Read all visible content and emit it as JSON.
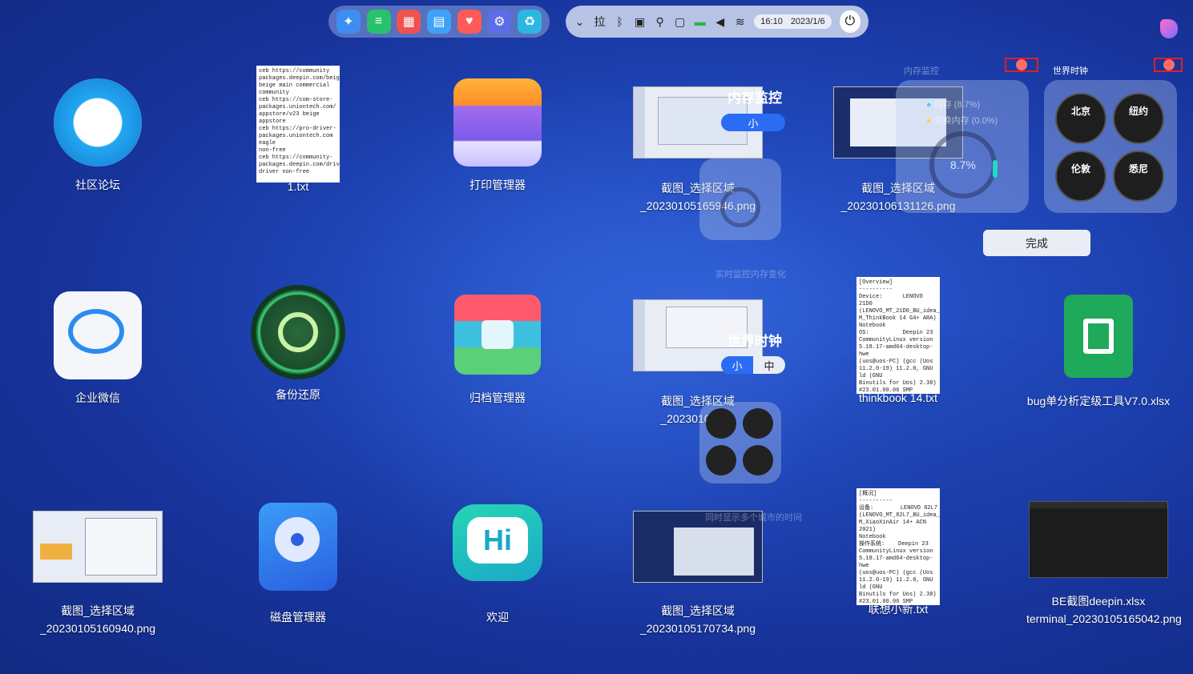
{
  "dock": {
    "icons": [
      "launcher-icon",
      "multitask-icon",
      "app-store-icon",
      "file-manager-icon",
      "gift-icon",
      "settings-icon",
      "trash-icon"
    ]
  },
  "tray": {
    "time": "16:10",
    "date": "2023/1/6"
  },
  "desktop": {
    "items": [
      {
        "label": "社区论坛"
      },
      {
        "label": "1.txt"
      },
      {
        "label": "打印管理器"
      },
      {
        "label": "截图_选择区域\n_20230105165946.png"
      },
      {
        "label": "截图_选择区域\n_20230106131126.png"
      },
      {
        "label": "企业微信"
      },
      {
        "label": "备份还原"
      },
      {
        "label": "归档管理器"
      },
      {
        "label": "截图_选择区域\n_20230105170"
      },
      {
        "label": "thinkbook 14.txt"
      },
      {
        "label": "bug单分析定级工具V7.0.xlsx"
      },
      {
        "label": "截图_选择区域\n_20230105160940.png"
      },
      {
        "label": "磁盘管理器"
      },
      {
        "label": "欢迎"
      },
      {
        "label": "截图_选择区域\n_20230105170734.png"
      },
      {
        "label": "联想小新.txt"
      },
      {
        "label": "BE截图deepin.xlsx"
      },
      {
        "label": "terminal_20230105165042.png"
      }
    ],
    "doc1_text": "ceb https://community\npackages.deepin.com/beige/\nbeige main commercial\ncommunity\nceb https://com-store-\npackages.uniontech.com/\nappstore/v23 beige appstore\nceb https://pro-driver-\npackages.uniontech.com eagle\nnon-free\nceb https://community-\npackages.deepin.com/driver/\ndriver non-free",
    "doc2_text": "[Overview]\n----------\nDevice:      LENOVO 21D0\n(LENOVO_MT_21D0_BU_idea_F\nM_ThinkBook 14 G4+ ARA)\nNotebook\nOS:          Deepin 23\nCommunityLinux version\n5.18.17-amd64-desktop-hwe\n(uos@uos-PC) (gcc (Uos\n11.2.0-19) 11.2.0, GNU ld (GNU\nBinutils for Uos) 2.38)\n#23.01.00.06 SMP\nPREEMPT_DYNAMIC Mon Oct 31",
    "doc3_text": "[概况]\n----------\n设备:        LENOVO 82L7\n(LENOVO_MT_82L7_BU_idea_F\nM_XiaoXinAir 14+ ACN 2021)\nNotebook\n操作系统:    Deepin 23\nCommunityLinux version\n5.18.17-amd64-desktop-hwe\n(uos@uos-PC) (gcc (Uos\n11.2.0-19) 11.2.0, GNU ld (GNU\nBinutils for Uos) 2.38)\n#23.01.00.06 SMP\nPREEMPT_DYNAMIC Mon Oct 31"
  },
  "widgets": {
    "memory_title": "内存监控",
    "memory_size_small": "小",
    "memory_desc": "实时监控内存变化",
    "clock_title": "世界时钟",
    "clock_size_small": "小",
    "clock_size_mid": "中",
    "clock_desc": "同时显示多个城市的时间",
    "memory_widget": {
      "title": "内存监控",
      "mem_label": "内存 (8.7%)",
      "swap_label": "交换内存 (0.0%)",
      "percent": "8.7%",
      "percent_value": 8.7
    },
    "clock_widget": {
      "title": "世界时钟",
      "cities": [
        "北京",
        "纽约",
        "伦敦",
        "悉尼"
      ]
    },
    "done_label": "完成"
  },
  "colors": {
    "accent": "#2a6df4",
    "remove_red": "#e02020"
  }
}
